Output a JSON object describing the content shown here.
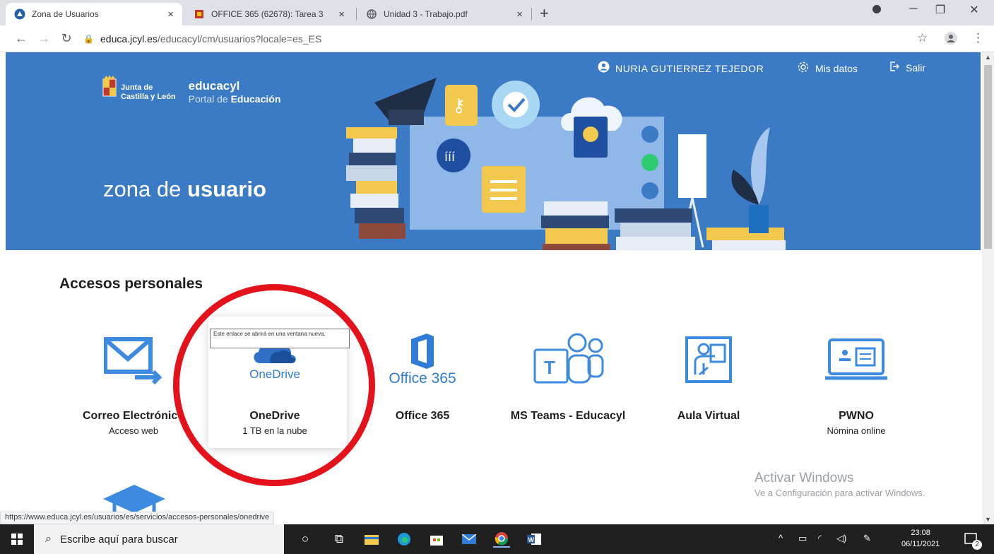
{
  "browser": {
    "tabs": [
      {
        "title": "Zona de Usuarios",
        "close": "×"
      },
      {
        "title": "OFFICE 365 (62678): Tarea 3",
        "close": "×"
      },
      {
        "title": "Unidad 3 - Trabajo.pdf",
        "close": "×"
      }
    ],
    "new_tab": "+",
    "url_host": "educa.jcyl.es",
    "url_path": "/educacyl/cm/usuarios?locale=es_ES"
  },
  "header": {
    "junta_line1": "Junta de",
    "junta_line2": "Castilla y León",
    "brand": "educacyl",
    "portal_prefix": "Portal de ",
    "portal_bold": "Educación",
    "zona_prefix": "zona de ",
    "zona_bold": "usuario",
    "user_name": "NURIA GUTIERREZ TEJEDOR",
    "mis_datos": "Mis datos",
    "salir": "Salir"
  },
  "section": {
    "title": "Accesos personales",
    "tiles": [
      {
        "name": "Correo Electrónico",
        "sub": "Acceso web"
      },
      {
        "name": "OneDrive",
        "sub": "1 TB en la nube",
        "logo_text": "OneDrive"
      },
      {
        "name": "Office 365",
        "logo_text": "Office 365"
      },
      {
        "name": "MS Teams - Educacyl"
      },
      {
        "name": "Aula Virtual"
      },
      {
        "name": "PWNO",
        "sub": "Nómina online"
      }
    ],
    "tooltip": "Este enlace se abrirá en una ventana nueva."
  },
  "watermark": {
    "line1": "Activar Windows",
    "line2": "Ve a Configuración para activar Windows."
  },
  "status_url": "https://www.educa.jcyl.es/usuarios/es/servicios/accesos-personales/onedrive",
  "taskbar": {
    "search_placeholder": "Escribe aquí para buscar",
    "time": "23:08",
    "date": "06/11/2021",
    "notifications": "2"
  },
  "colors": {
    "banner": "#3b7ac4",
    "brand_blue": "#2f7bd6",
    "highlight_circle": "#e3121b"
  }
}
